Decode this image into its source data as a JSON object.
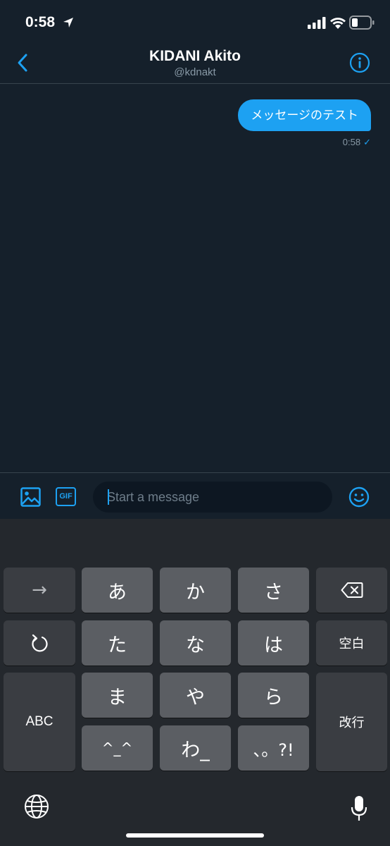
{
  "status_bar": {
    "time": "0:58"
  },
  "header": {
    "title": "KIDANI Akito",
    "handle": "@kdnakt"
  },
  "conversation": {
    "messages": [
      {
        "text": "メッセージのテスト",
        "time": "0:58",
        "status_glyph": "✓"
      }
    ]
  },
  "composer": {
    "gif_label": "GIF",
    "placeholder": "Start a message",
    "value": ""
  },
  "keyboard": {
    "row1": [
      "→",
      "あ",
      "か",
      "さ"
    ],
    "row2": [
      "た",
      "な",
      "は",
      "空白"
    ],
    "row3": [
      "ABC",
      "ま",
      "や",
      "ら",
      "改行"
    ],
    "row4": [
      "^_^",
      "わ_",
      "、。?!"
    ]
  },
  "colors": {
    "accent": "#1da1f2",
    "background": "#15202b",
    "keyboard": "#24282d"
  },
  "icons": [
    "location-arrow-icon",
    "signal-icon",
    "wifi-icon",
    "battery-icon",
    "back-chevron-icon",
    "info-icon",
    "image-icon",
    "emoji-icon",
    "backspace-icon",
    "undo-icon",
    "globe-icon",
    "microphone-icon"
  ]
}
